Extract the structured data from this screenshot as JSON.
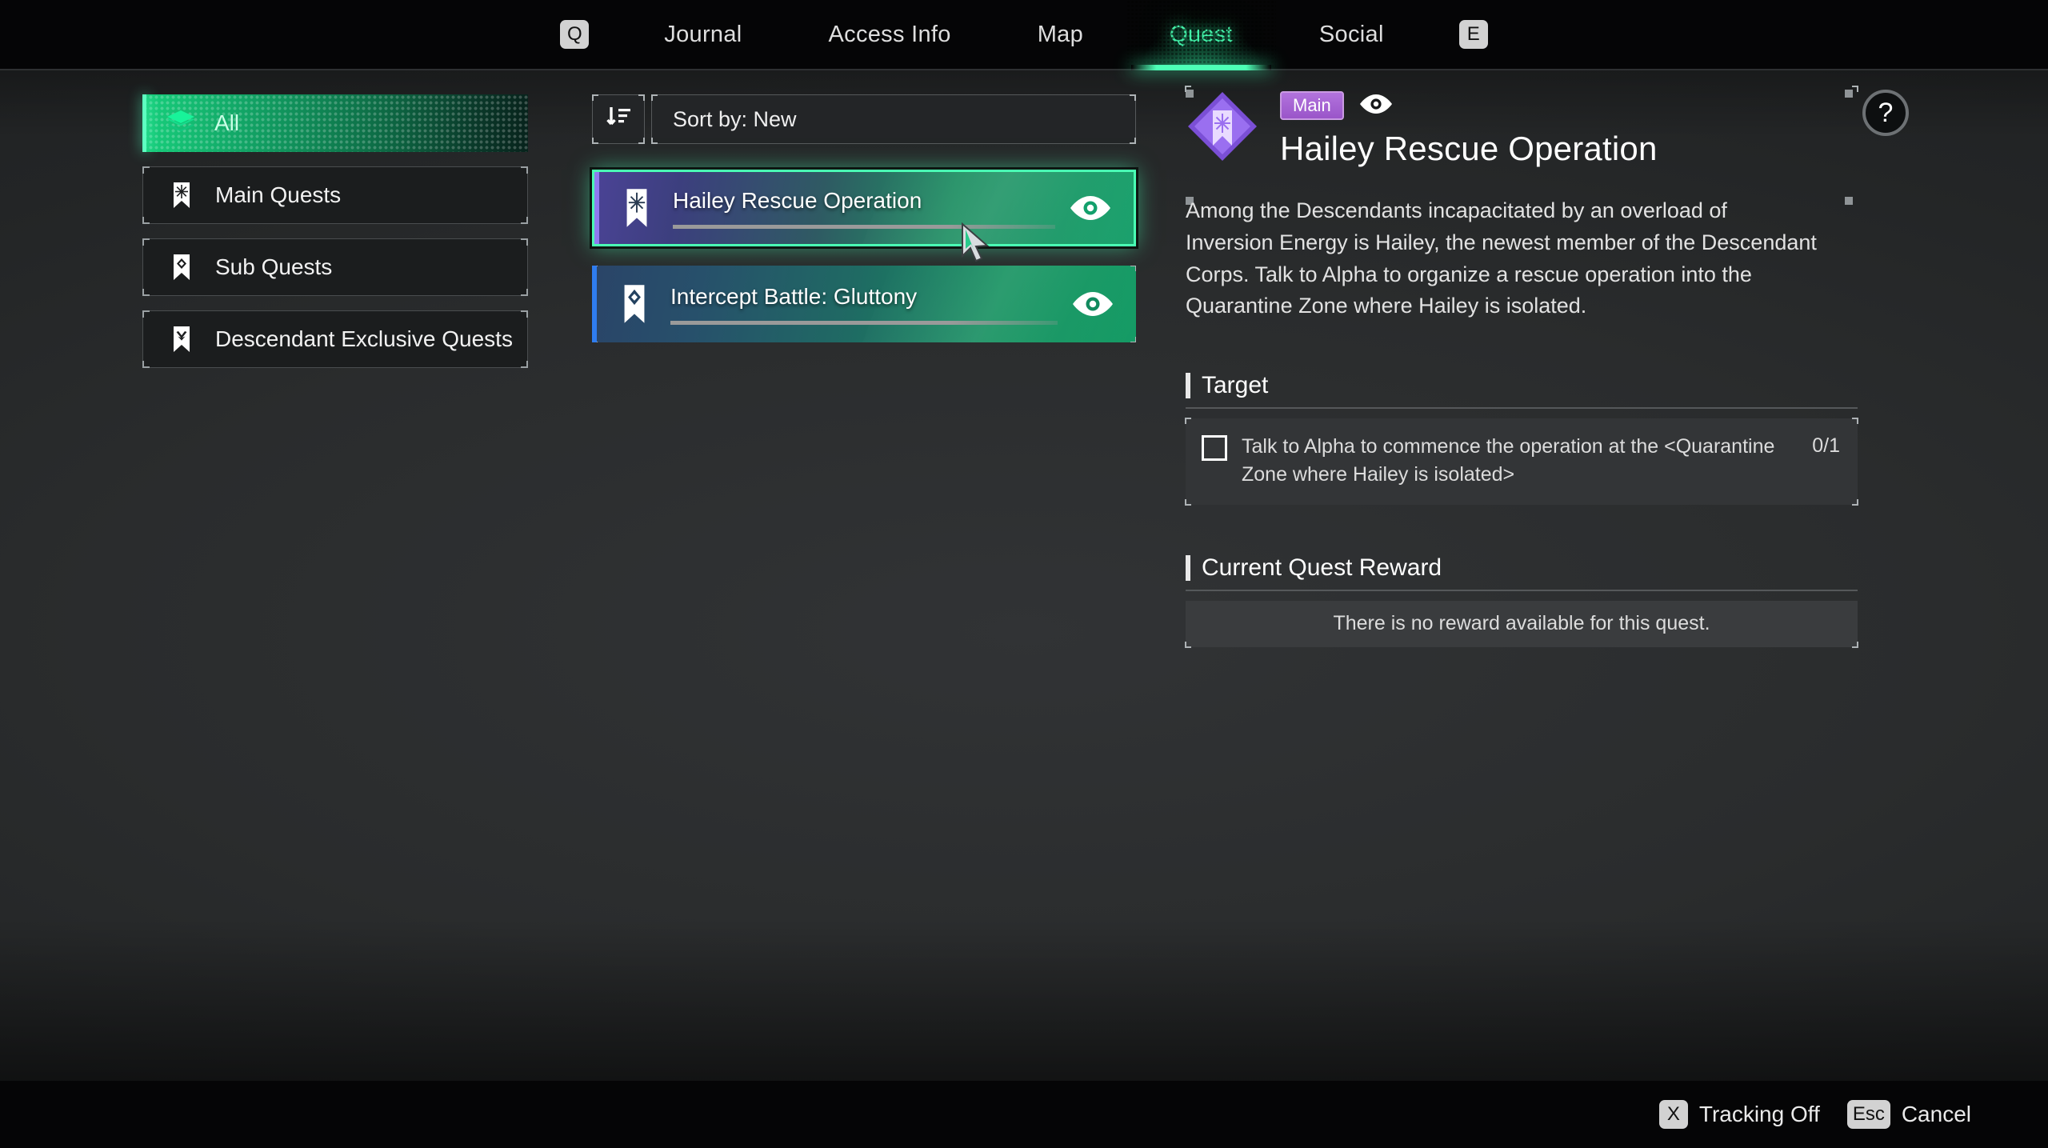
{
  "nav": {
    "left_key": "Q",
    "right_key": "E",
    "tabs": [
      {
        "label": "Journal",
        "active": false
      },
      {
        "label": "Access Info",
        "active": false
      },
      {
        "label": "Map",
        "active": false
      },
      {
        "label": "Quest",
        "active": true
      },
      {
        "label": "Social",
        "active": false
      }
    ],
    "active_color": "#44f0a8"
  },
  "sidebar": {
    "items": [
      {
        "label": "All",
        "icon": "layers-icon",
        "selected": true
      },
      {
        "label": "Main Quests",
        "icon": "bookmark-star-icon",
        "selected": false
      },
      {
        "label": "Sub Quests",
        "icon": "bookmark-diamond-icon",
        "selected": false
      },
      {
        "label": "Descendant Exclusive Quests",
        "icon": "bookmark-chevron-icon",
        "selected": false
      }
    ]
  },
  "list": {
    "sort_icon": "sort-descending-icon",
    "sort_label": "Sort by: New",
    "quests": [
      {
        "title": "Hailey Rescue Operation",
        "type": "main",
        "icon": "bookmark-star-icon",
        "track_icon": "eye-icon",
        "selected": true
      },
      {
        "title": "Intercept Battle: Gluttony",
        "type": "sub",
        "icon": "bookmark-diamond-icon",
        "track_icon": "eye-icon",
        "selected": false
      }
    ]
  },
  "detail": {
    "badge_icon": "quest-diamond-badge",
    "tag": "Main",
    "tag_color": "#9a55c9",
    "track_icon": "eye-icon",
    "title": "Hailey Rescue Operation",
    "description": "Among the Descendants incapacitated by an overload of Inversion Energy is Hailey, the newest member of the Descendant Corps. Talk to Alpha to organize a rescue operation into the Quarantine Zone where Hailey is isolated.",
    "target_heading": "Target",
    "objectives": [
      {
        "text": "Talk to Alpha to commence the operation at the <Quarantine Zone where Hailey is isolated>",
        "count": "0/1",
        "complete": false
      }
    ],
    "reward_heading": "Current Quest Reward",
    "reward_text": "There is no reward available for this quest."
  },
  "help": {
    "label": "?"
  },
  "footer": {
    "hints": [
      {
        "key": "X",
        "label": "Tracking Off"
      },
      {
        "key": "Esc",
        "label": "Cancel"
      }
    ]
  }
}
